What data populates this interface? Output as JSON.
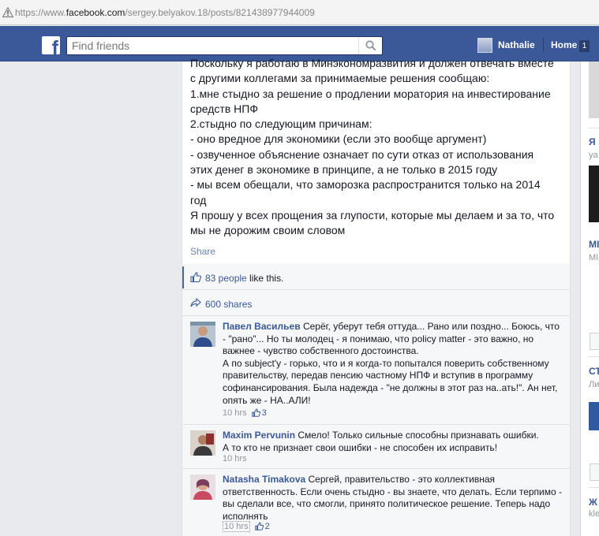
{
  "browser": {
    "url_prefix": "https://www.",
    "url_host": "facebook.com",
    "url_path": "/sergey.belyakov.18/posts/821438977944009"
  },
  "topbar": {
    "logo": "f",
    "search_placeholder": "Find friends",
    "user_name": "Nathalie",
    "home_label": "Home",
    "home_count": "1"
  },
  "post": {
    "text": "Поскольку я работаю в Минэкономразвития и должен отвечать вместе\nс другими коллегами за принимаемые решения сообщаю:\n1.мне стыдно за решение о продлении моратория на инвестирование\nсредств НПФ\n2.стыдно по следующим причинам:\n- оно вредное для экономики (если это вообще аргумент)\n- озвученное объяснение означает по сути отказ от использования\nэтих денег в экономике в принципе, а не только в 2015 году\n- мы всем обещали, что заморозка распространится только на 2014\nгод\nЯ прошу у всех прощения за глупости, которые мы делаем и за то, что\nмы не дорожим своим словом",
    "share_label": "Share"
  },
  "feedback": {
    "likes_people": "83 people",
    "likes_suffix": " like this.",
    "shares": "600 shares"
  },
  "comments": [
    {
      "author": "Павел Васильев",
      "text": "Серёг, уберут тебя оттуда... Рано или поздно... Боюсь, что - \"рано\"... Но ты молодец - я понимаю, что policy matter - это важно, но важнее - чувство собственного достоинства.\nА по subject'у - горько, что и я когда-то попытался поверить собственному правительству, передав пенсию частному НПФ и вступив в программу софинансирования. Была надежда - \"не должны в этот раз на..ать!\". Ан нет, опять же - НА..АЛИ!",
      "time": "10 hrs",
      "likes": "3"
    },
    {
      "author": "Maxim Pervunin",
      "text": "Смело! Только сильные способны признавать ошибки.\nА то кто не признает свои ошибки - не способен их исправить!",
      "time": "10 hrs",
      "likes": ""
    },
    {
      "author": "Natasha Timakova",
      "text": "Сергей, правительство - это коллективная ответственность. Если очень стыдно - вы знаете, что делать. Если терпимо - вы сделали все, что смогли, принято политическое решение. Теперь надо исполнять",
      "time": "10 hrs",
      "likes": "2"
    }
  ],
  "right_column": {
    "item1_title": "Я",
    "item1_sub": "ya",
    "item2_title": "МІ",
    "item2_sub": "МІ",
    "item3_title": "СТ",
    "item3_sub": "Ли",
    "item4_title": "Ж",
    "item4_sub": "kle"
  },
  "colors": {
    "facebook_blue": "#3b5998",
    "link_blue": "#3b5998",
    "background": "#e9eaed"
  }
}
